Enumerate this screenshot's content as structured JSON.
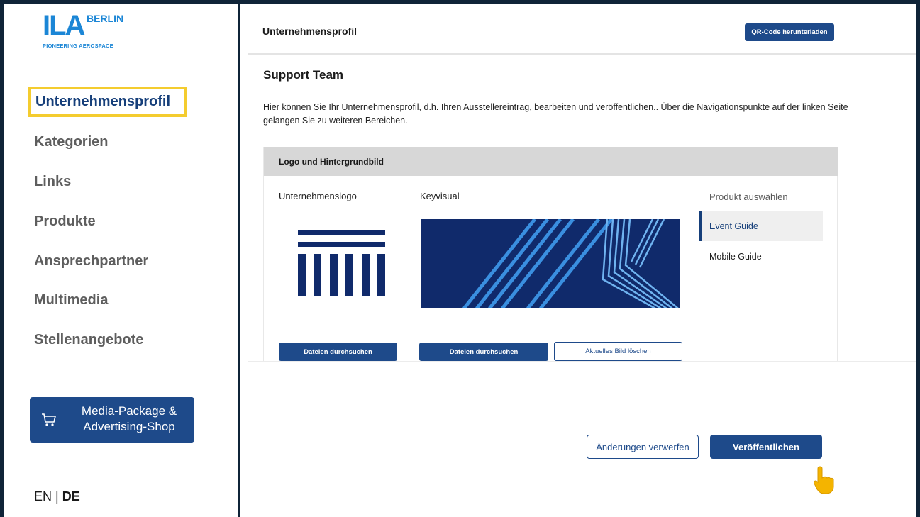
{
  "brand": {
    "logo_text": "ILA",
    "city": "BERLIN",
    "tagline": "PIONEERING AEROSPACE",
    "color": "#1b86d6"
  },
  "sidebar": {
    "items": [
      {
        "label": "Unternehmensprofil",
        "active": true
      },
      {
        "label": "Kategorien"
      },
      {
        "label": "Links"
      },
      {
        "label": "Produkte"
      },
      {
        "label": "Ansprechpartner"
      },
      {
        "label": "Multimedia"
      },
      {
        "label": "Stellenangebote"
      }
    ],
    "shop_button": {
      "line1": "Media-Package &",
      "line2": "Advertising-Shop",
      "icon": "cart-icon"
    },
    "lang": {
      "en": "EN",
      "sep": " | ",
      "de": "DE"
    }
  },
  "header": {
    "title": "Unternehmensprofil",
    "qr_button": "QR-Code herunterladen"
  },
  "main": {
    "section_title": "Support Team",
    "description": "Hier können Sie Ihr Unternehmensprofil, d.h. Ihren Ausstellereintrag, bearbeiten und veröffentlichen.. Über die Navigationspunkte auf der linken Seite gelangen Sie zu weiteren Bereichen.",
    "card": {
      "title": "Logo und Hintergrundbild",
      "logo_label": "Unternehmenslogo",
      "keyvisual_label": "Keyvisual",
      "product_label": "Produkt auswählen",
      "products": [
        {
          "label": "Event Guide",
          "active": true
        },
        {
          "label": "Mobile Guide"
        }
      ],
      "browse_logo": "Dateien durchsuchen",
      "browse_keyvisual": "Dateien durchsuchen",
      "delete_image": "Aktuelles Bild löschen"
    },
    "actions": {
      "discard": "Änderungen verwerfen",
      "publish": "Veröffentlichen"
    }
  },
  "colors": {
    "primary": "#1e4a8a",
    "highlight": "#f4cc2f",
    "navy": "#102a6b",
    "stripe": "#3a8fe0",
    "cursor": "#f4b400"
  }
}
